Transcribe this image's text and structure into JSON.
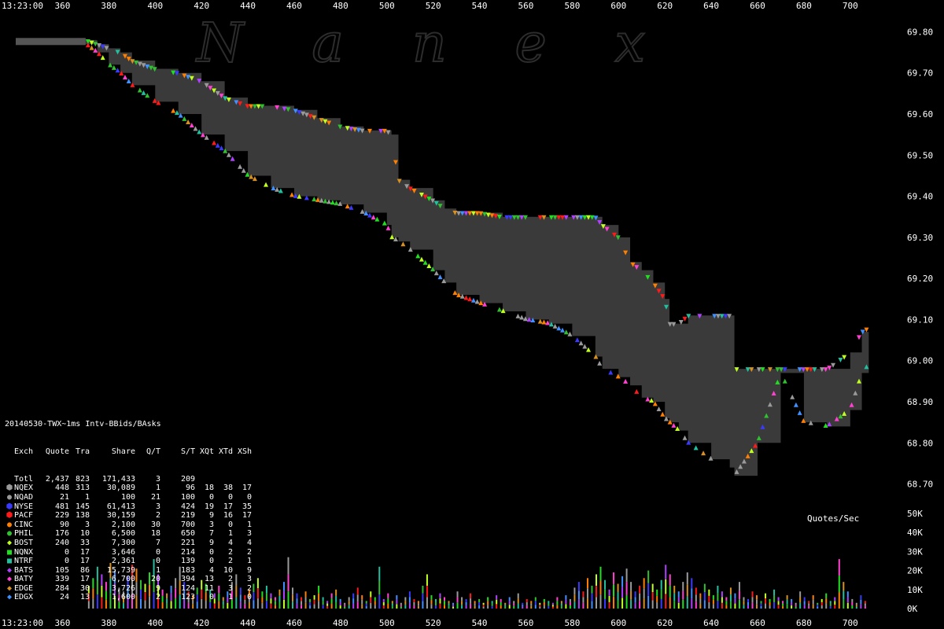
{
  "header": {
    "time_label": "13:23:00",
    "watermark": "Nanex"
  },
  "stats": {
    "title": "20140530-TWX~1ms Intv-BBids/BAsks",
    "columns": [
      "Exch",
      "Quote",
      "Tra",
      "Share",
      "Q/T",
      "S/T",
      "XQt",
      "XTd",
      "XSh"
    ],
    "rows": [
      {
        "exch": "Totl",
        "quote": "2,437",
        "tra": "823",
        "share": "171,433",
        "qt": "3",
        "st": "209",
        "xqt": "",
        "xtd": "",
        "xsh": "",
        "color": "",
        "marker": ""
      },
      {
        "exch": "NQEX",
        "quote": "448",
        "tra": "313",
        "share": "30,089",
        "qt": "1",
        "st": "96",
        "xqt": "18",
        "xtd": "38",
        "xsh": "17",
        "color": "#9a9a9a",
        "marker": "⬢"
      },
      {
        "exch": "NQAD",
        "quote": "21",
        "tra": "1",
        "share": "100",
        "qt": "21",
        "st": "100",
        "xqt": "0",
        "xtd": "0",
        "xsh": "0",
        "color": "#9a9a9a",
        "marker": "●"
      },
      {
        "exch": "NYSE",
        "quote": "481",
        "tra": "145",
        "share": "61,413",
        "qt": "3",
        "st": "424",
        "xqt": "19",
        "xtd": "17",
        "xsh": "35",
        "color": "#3a3aff",
        "marker": "⬢"
      },
      {
        "exch": "PACF",
        "quote": "229",
        "tra": "138",
        "share": "30,159",
        "qt": "2",
        "st": "219",
        "xqt": "9",
        "xtd": "16",
        "xsh": "17",
        "color": "#ff1a1a",
        "marker": "⬢"
      },
      {
        "exch": "CINC",
        "quote": "90",
        "tra": "3",
        "share": "2,100",
        "qt": "30",
        "st": "700",
        "xqt": "3",
        "xtd": "0",
        "xsh": "1",
        "color": "#ff7f00",
        "marker": "●"
      },
      {
        "exch": "PHIL",
        "quote": "176",
        "tra": "10",
        "share": "6,500",
        "qt": "18",
        "st": "650",
        "xqt": "7",
        "xtd": "1",
        "xsh": "3",
        "color": "#30c030",
        "marker": "●"
      },
      {
        "exch": "BOST",
        "quote": "240",
        "tra": "33",
        "share": "7,300",
        "qt": "7",
        "st": "221",
        "xqt": "9",
        "xtd": "4",
        "xsh": "4",
        "color": "#c0ff20",
        "marker": "◆"
      },
      {
        "exch": "NQNX",
        "quote": "0",
        "tra": "17",
        "share": "3,646",
        "qt": "0",
        "st": "214",
        "xqt": "0",
        "xtd": "2",
        "xsh": "2",
        "color": "#20e020",
        "marker": "■"
      },
      {
        "exch": "NTRF",
        "quote": "0",
        "tra": "17",
        "share": "2,361",
        "qt": "0",
        "st": "139",
        "xqt": "0",
        "xtd": "2",
        "xsh": "1",
        "color": "#20c0a0",
        "marker": "■"
      },
      {
        "exch": "BATS",
        "quote": "105",
        "tra": "86",
        "share": "15,739",
        "qt": "1",
        "st": "183",
        "xqt": "4",
        "xtd": "10",
        "xsh": "9",
        "color": "#b040ff",
        "marker": "◆"
      },
      {
        "exch": "BATY",
        "quote": "339",
        "tra": "17",
        "share": "6,700",
        "qt": "20",
        "st": "394",
        "xqt": "13",
        "xtd": "2",
        "xsh": "3",
        "color": "#ff40d0",
        "marker": "◆"
      },
      {
        "exch": "EDGE",
        "quote": "284",
        "tra": "30",
        "share": "3,726",
        "qt": "9",
        "st": "124",
        "xqt": "11",
        "xtd": "3",
        "xsh": "2",
        "color": "#d89020",
        "marker": "◆"
      },
      {
        "exch": "EDGX",
        "quote": "24",
        "tra": "13",
        "share": "1,600",
        "qt": "2",
        "st": "123",
        "xqt": "0",
        "xtd": "1",
        "xsh": "0",
        "color": "#4090ff",
        "marker": "◆"
      }
    ]
  },
  "volume_label": "Quotes/Sec",
  "chart_data": {
    "type": "area",
    "x_ticks": [
      "360",
      "380",
      "400",
      "420",
      "440",
      "460",
      "480",
      "500",
      "520",
      "540",
      "560",
      "580",
      "600",
      "620",
      "640",
      "660",
      "680",
      "700"
    ],
    "xlim": [
      350,
      715
    ],
    "price_ticks": [
      "69.80",
      "69.70",
      "69.60",
      "69.50",
      "69.40",
      "69.30",
      "69.20",
      "69.10",
      "69.00",
      "68.90",
      "68.80",
      "68.70"
    ],
    "ylim": [
      68.68,
      69.82
    ],
    "volume_ticks": [
      "50K",
      "40K",
      "30K",
      "20K",
      "10K",
      "0K"
    ],
    "volume_ylim": [
      0,
      50000
    ],
    "colors": {
      "spread_fill": "#3a3a3a",
      "background": "#000000",
      "text": "#ffffff"
    },
    "series": [
      {
        "role": "best_ask",
        "x": [
          350,
          370,
          375,
          380,
          385,
          390,
          400,
          410,
          420,
          430,
          440,
          450,
          460,
          470,
          480,
          490,
          500,
          502,
          505,
          510,
          520,
          525,
          530,
          540,
          550,
          560,
          570,
          580,
          590,
          593,
          600,
          605,
          610,
          615,
          620,
          622,
          626,
          630,
          640,
          648,
          650,
          660,
          670,
          680,
          690,
          700,
          705,
          708
        ],
        "values": [
          69.78,
          69.78,
          69.77,
          69.76,
          69.75,
          69.73,
          69.71,
          69.7,
          69.68,
          69.64,
          69.62,
          69.62,
          69.61,
          69.59,
          69.57,
          69.56,
          69.56,
          69.55,
          69.44,
          69.42,
          69.39,
          69.37,
          69.36,
          69.36,
          69.35,
          69.35,
          69.35,
          69.35,
          69.35,
          69.33,
          69.3,
          69.24,
          69.22,
          69.19,
          69.15,
          69.09,
          69.09,
          69.11,
          69.11,
          69.11,
          68.98,
          68.98,
          68.98,
          68.98,
          68.98,
          69.02,
          69.07,
          69.08
        ]
      },
      {
        "role": "best_bid",
        "x": [
          350,
          370,
          375,
          380,
          385,
          390,
          400,
          410,
          420,
          430,
          440,
          450,
          460,
          470,
          480,
          490,
          500,
          502,
          505,
          510,
          520,
          525,
          530,
          540,
          550,
          560,
          570,
          580,
          590,
          593,
          600,
          605,
          610,
          615,
          620,
          622,
          626,
          630,
          640,
          648,
          650,
          660,
          670,
          680,
          690,
          700,
          705,
          708
        ],
        "values": [
          69.78,
          69.77,
          69.75,
          69.72,
          69.7,
          69.67,
          69.63,
          69.6,
          69.55,
          69.51,
          69.45,
          69.42,
          69.4,
          69.39,
          69.38,
          69.36,
          69.33,
          69.3,
          69.29,
          69.27,
          69.22,
          69.19,
          69.16,
          69.14,
          69.12,
          69.1,
          69.09,
          69.06,
          69.01,
          68.98,
          68.96,
          68.94,
          68.91,
          68.9,
          68.86,
          68.85,
          68.83,
          68.8,
          68.76,
          68.74,
          68.72,
          68.8,
          68.97,
          68.85,
          68.84,
          68.88,
          68.97,
          68.99
        ]
      }
    ],
    "volume_samples": [
      12,
      16,
      22,
      18,
      14,
      24,
      20,
      11,
      9,
      17,
      23,
      21,
      15,
      13,
      19,
      26,
      18,
      10,
      8,
      12,
      16,
      22,
      14,
      9,
      7,
      11,
      15,
      13,
      10,
      8,
      12,
      6,
      9,
      14,
      18,
      11,
      7,
      10,
      13,
      16,
      9,
      12,
      8,
      6,
      10,
      14,
      27,
      11,
      8,
      6,
      9,
      5,
      7,
      12,
      6,
      4,
      8,
      10,
      5,
      3,
      6,
      8,
      11,
      7,
      4,
      9,
      6,
      22,
      5,
      8,
      4,
      7,
      3,
      6,
      9,
      5,
      4,
      12,
      18,
      7,
      5,
      8,
      6,
      4,
      3,
      9,
      6,
      5,
      8,
      4,
      5,
      3,
      6,
      4,
      7,
      5,
      3,
      6,
      4,
      8,
      3,
      5,
      4,
      6,
      3,
      5,
      4,
      3,
      6,
      4,
      7,
      5,
      11,
      14,
      9,
      16,
      12,
      18,
      22,
      15,
      10,
      19,
      13,
      17,
      21,
      14,
      9,
      12,
      16,
      20,
      13,
      10,
      15,
      23,
      18,
      12,
      9,
      14,
      19,
      16,
      11,
      8,
      13,
      10,
      7,
      12,
      9,
      6,
      11,
      8,
      14,
      6,
      5,
      9,
      7,
      4,
      8,
      5,
      10,
      6,
      4,
      7,
      5,
      3,
      9,
      6,
      4,
      7,
      3,
      5,
      8,
      4,
      6,
      26,
      14,
      9,
      5,
      3,
      7,
      4
    ]
  }
}
